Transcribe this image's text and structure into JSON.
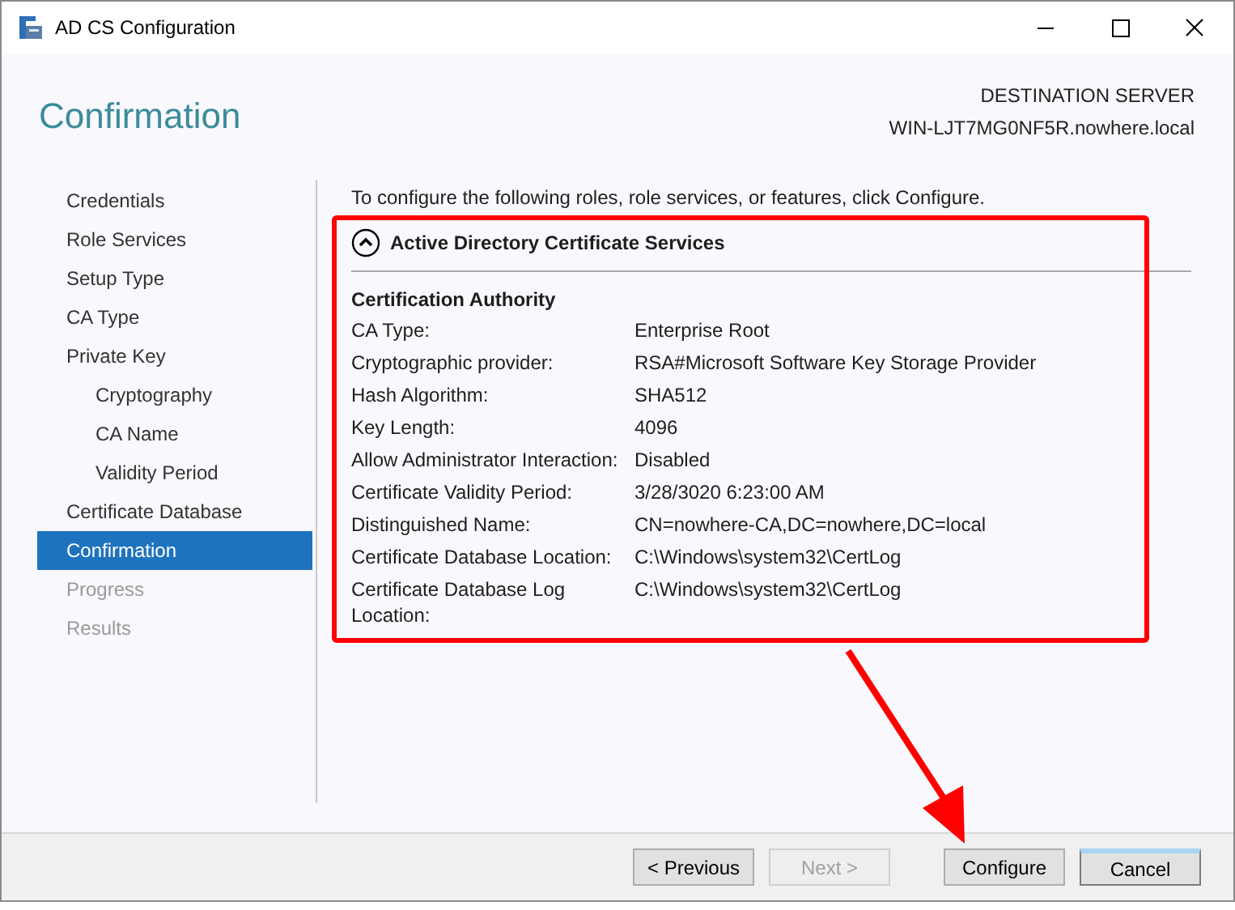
{
  "window": {
    "title": "AD CS Configuration"
  },
  "header": {
    "title": "Confirmation",
    "server_label": "DESTINATION SERVER",
    "server_name": "WIN-LJT7MG0NF5R.nowhere.local"
  },
  "steps": [
    {
      "label": "Credentials",
      "selected": false,
      "disabled": false
    },
    {
      "label": "Role Services",
      "selected": false,
      "disabled": false
    },
    {
      "label": "Setup Type",
      "selected": false,
      "disabled": false
    },
    {
      "label": "CA Type",
      "selected": false,
      "disabled": false
    },
    {
      "label": "Private Key",
      "selected": false,
      "disabled": false,
      "children": [
        {
          "label": "Cryptography",
          "selected": false,
          "disabled": false
        },
        {
          "label": "CA Name",
          "selected": false,
          "disabled": false
        },
        {
          "label": "Validity Period",
          "selected": false,
          "disabled": false
        }
      ]
    },
    {
      "label": "Certificate Database",
      "selected": false,
      "disabled": false
    },
    {
      "label": "Confirmation",
      "selected": true,
      "disabled": false
    },
    {
      "label": "Progress",
      "selected": false,
      "disabled": true
    },
    {
      "label": "Results",
      "selected": false,
      "disabled": true
    }
  ],
  "intro": "To configure the following roles, role services, or features, click Configure.",
  "section": {
    "title": "Active Directory Certificate Services",
    "expanded": true,
    "subtitle": "Certification Authority",
    "rows": [
      {
        "label": "CA Type:",
        "value": "Enterprise Root"
      },
      {
        "label": "Cryptographic provider:",
        "value": "RSA#Microsoft Software Key Storage Provider"
      },
      {
        "label": "Hash Algorithm:",
        "value": "SHA512"
      },
      {
        "label": "Key Length:",
        "value": "4096"
      },
      {
        "label": "Allow Administrator Interaction:",
        "value": "Disabled"
      },
      {
        "label": "Certificate Validity Period:",
        "value": "3/28/3020 6:23:00 AM"
      },
      {
        "label": "Distinguished Name:",
        "value": "CN=nowhere-CA,DC=nowhere,DC=local"
      },
      {
        "label": "Certificate Database Location:",
        "value": "C:\\Windows\\system32\\CertLog"
      },
      {
        "label": "Certificate Database Log Location:",
        "value": "C:\\Windows\\system32\\CertLog"
      }
    ]
  },
  "buttons": [
    {
      "label": "< Previous",
      "disabled": false,
      "default": false
    },
    {
      "label": "Next >",
      "disabled": true,
      "default": false
    },
    {
      "label": "Configure",
      "disabled": false,
      "default": false
    },
    {
      "label": "Cancel",
      "disabled": false,
      "default": true
    }
  ],
  "annotations": {
    "highlight_box": true,
    "arrow": true
  }
}
